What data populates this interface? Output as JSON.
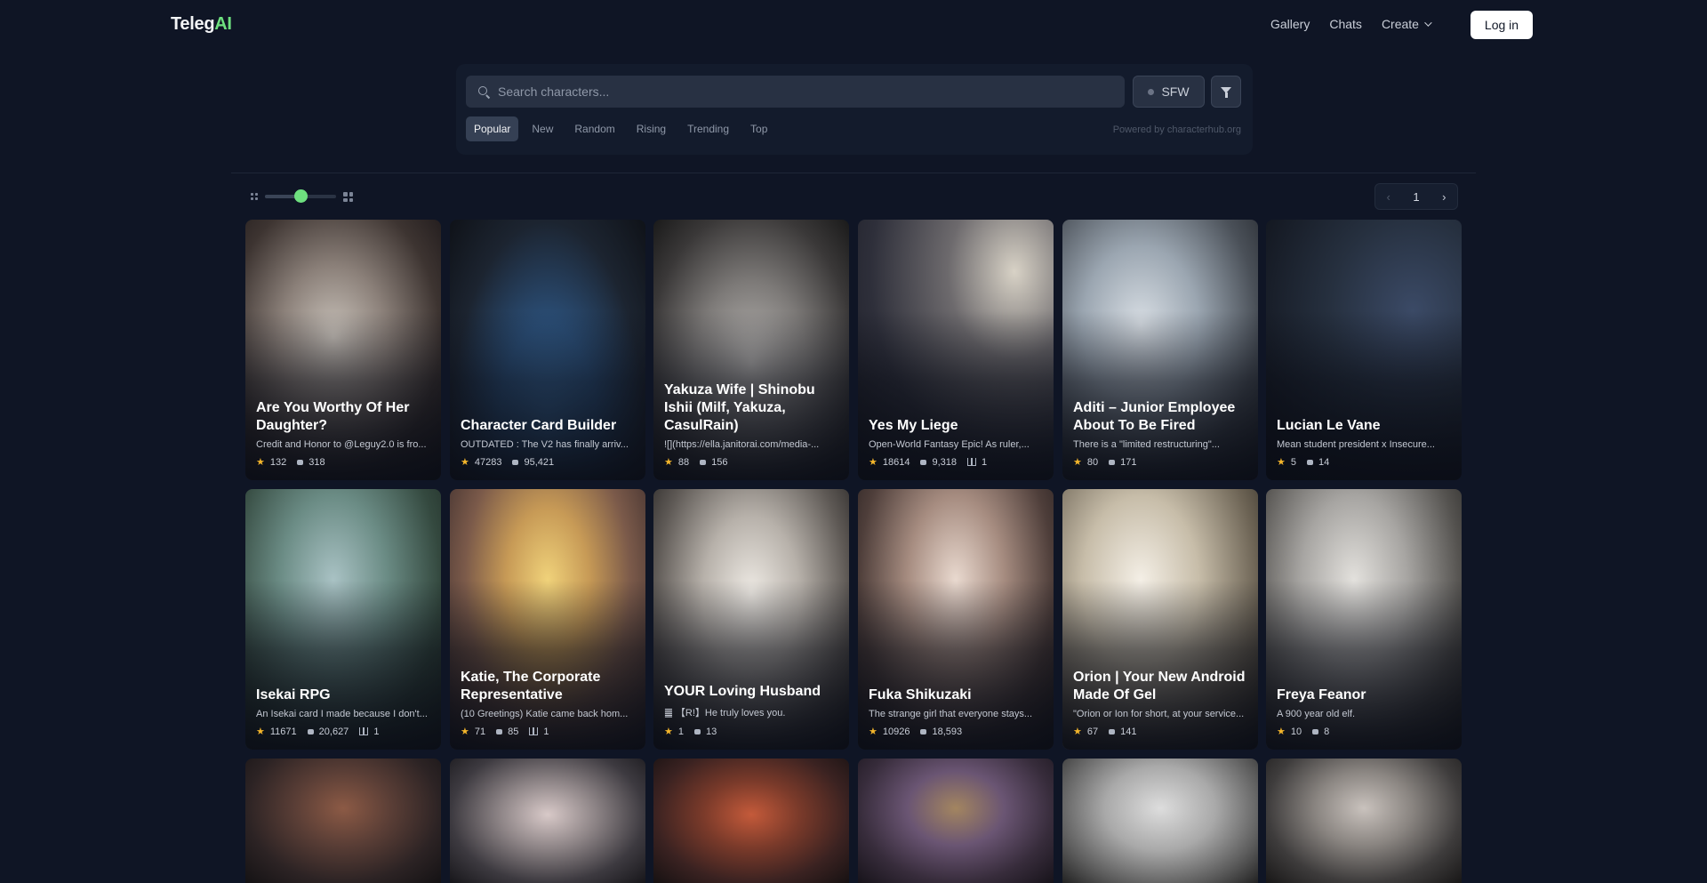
{
  "nav": {
    "brand_main": "Teleg",
    "brand_accent": "AI",
    "links": [
      "Gallery",
      "Chats",
      "Create"
    ],
    "login": "Log in"
  },
  "search": {
    "placeholder": "Search characters...",
    "sfw_label": "SFW",
    "tabs": [
      "Popular",
      "New",
      "Random",
      "Rising",
      "Trending",
      "Top"
    ],
    "active_tab": "Popular",
    "powered_by": "Powered by characterhub.org"
  },
  "toolbar": {
    "grid_size_level": 0.5,
    "page": "1"
  },
  "colors": {
    "background": "#0f1525",
    "accent": "#6ee07f",
    "star": "#f3b52b"
  },
  "cards_row1": [
    {
      "title": "Are You Worthy Of Her Daughter?",
      "desc": "Credit and Honor to @Leguy2.0 is fro...",
      "stars": "132",
      "chats": "318",
      "books": ""
    },
    {
      "title": "Character Card Builder",
      "desc": "OUTDATED : The V2 has finally arriv...",
      "stars": "47283",
      "chats": "95,421",
      "books": ""
    },
    {
      "title": "Yakuza Wife | Shinobu Ishii (Milf, Yakuza, CasulRain)",
      "desc": "![](https://ella.janitorai.com/media-...",
      "stars": "88",
      "chats": "156",
      "books": ""
    },
    {
      "title": "Yes My Liege",
      "desc": "Open-World Fantasy Epic! As ruler,...",
      "stars": "18614",
      "chats": "9,318",
      "books": "1"
    },
    {
      "title": "Aditi – Junior Employee About To Be Fired",
      "desc": "There is a \"limited restructuring\"...",
      "stars": "80",
      "chats": "171",
      "books": ""
    },
    {
      "title": "Lucian Le Vane",
      "desc": "Mean student president x Insecure...",
      "stars": "5",
      "chats": "14",
      "books": ""
    }
  ],
  "cards_row2": [
    {
      "title": "Isekai RPG",
      "desc": "An Isekai card I made because I don't...",
      "stars": "11671",
      "chats": "20,627",
      "books": "1"
    },
    {
      "title": "Katie, The Corporate Representative",
      "desc": "(10 Greetings) Katie came back hom...",
      "stars": "71",
      "chats": "85",
      "books": "1"
    },
    {
      "title": "YOUR Loving Husband",
      "desc": "䷀ 【R!】He truly loves you.",
      "stars": "1",
      "chats": "13",
      "books": ""
    },
    {
      "title": "Fuka Shikuzaki",
      "desc": "The strange girl that everyone stays...",
      "stars": "10926",
      "chats": "18,593",
      "books": ""
    },
    {
      "title": "Orion | Your New Android Made Of Gel",
      "desc": "\"Orion or Ion for short, at your service...",
      "stars": "67",
      "chats": "141",
      "books": ""
    },
    {
      "title": "Freya Feanor",
      "desc": "A 900 year old elf.",
      "stars": "10",
      "chats": "8",
      "books": ""
    }
  ]
}
